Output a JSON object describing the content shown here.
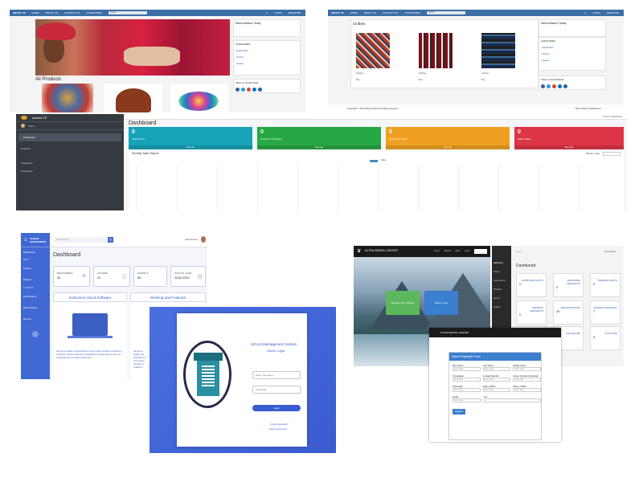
{
  "shop1": {
    "nav": [
      "HOME",
      "ABOUT US",
      "CONTACT US",
      "CATEGORIES"
    ],
    "brand": "ABOUT US",
    "right_nav": [
      "LOGIN",
      "REGISTER"
    ],
    "search_placeholder": "Search",
    "widget_title": "Meet Artisans Today",
    "cat_title": "CATEGORIES",
    "cat_links": [
      "Handicrafts",
      "Clothes",
      "Jewelry"
    ],
    "section_title": "All Products",
    "share_title": "Share on Social Media"
  },
  "shop2": {
    "section_title": "Clothes",
    "items": [
      "Clothes",
      "Clothes",
      "Clothes"
    ],
    "item_sub": [
      "Buy",
      "Buy",
      "Buy"
    ],
    "widget_title": "Meet Artisans Today",
    "cat_title": "CATEGORIES",
    "cat_links": [
      "Handicrafts",
      "Clothes",
      "Jewelry"
    ],
    "share_title": "Share on Social Media",
    "footer_left": "Copyright © 2021 Meet Artisans All rights reserved",
    "footer_right": "Meet Artisans Dashboard"
  },
  "admin": {
    "brand": "AdminLTE",
    "user": "Admin",
    "sidebar": [
      "Dashboard",
      "Products",
      "Categories",
      "Customers"
    ],
    "page_title": "Dashboard",
    "breadcrumb": "Home / Dashboard",
    "cards": [
      {
        "value": "0",
        "label": "Total Orders",
        "color": "#17a2b8"
      },
      {
        "value": "0",
        "label": "Number of Products",
        "color": "#28a745"
      },
      {
        "value": "0",
        "label": "Number of Users",
        "color": "#f0a020"
      },
      {
        "value": "0",
        "label": "Sales Today",
        "color": "#dc3545"
      }
    ],
    "more": "More info",
    "chart_title": "Monthly Sales Report",
    "chart_filter": "Month / Year",
    "legend": "Sales"
  },
  "school": {
    "sidebar_title": "SCHOOL MANAGEMENT",
    "menu": [
      "Dashboard",
      "Course",
      "Subject",
      "Add Student",
      "View Student",
      "Record"
    ],
    "menu_section_1": "MENU",
    "menu_section_2": "STUDENTS",
    "search_placeholder": "Search here",
    "user": "Administrator",
    "page_title": "Dashboard",
    "stats": [
      {
        "label": "REGISTERED",
        "value": "40"
      },
      {
        "label": "COURSE",
        "value": "21"
      },
      {
        "label": "SUBJECT",
        "value": "80"
      },
      {
        "label": "SCHOOL YEAR",
        "value": "2020-2021"
      }
    ],
    "panel1": "Instruction About Software",
    "panel2": "Working and Features",
    "panel_text": "Add some quality, svg illustrations to your project courtesy of unDraw, a constantly updated collection of beautiful svg images that you can use completely free and without attribution!",
    "login_title": "School Management System",
    "login_sub": "Admin Login",
    "username_ph": "Enter Username",
    "password_ph": "Password",
    "login_btn": "Login",
    "forgot": "Forgot Password?",
    "create": "Create an Account"
  },
  "dental": {
    "brand": "ULTRA DENTAL CENTER",
    "nav": [
      "Home",
      "Patients",
      "About",
      "Login"
    ],
    "btn_register": "Register New Patient",
    "btn_admin": "Admin Login",
    "dash_title": "Dashboard",
    "dash_search": "Search",
    "dash_user": "Administrator",
    "dash_sidebar": [
      "Dashboard",
      "Patient",
      "Appointments",
      "Schedule",
      "Record",
      "Settings"
    ],
    "tiles": [
      {
        "label": "APPROVED VISITS",
        "count": "0"
      },
      {
        "label": "APPROVED REQUESTS",
        "count": "0"
      },
      {
        "label": "PENDING VISITS",
        "count": "0"
      },
      {
        "label": "PENDING REQUESTS",
        "count": "0"
      },
      {
        "label": "REGISTRATIONS",
        "count": "26"
      },
      {
        "label": "PENDING REQUEST",
        "count": "7"
      },
      {
        "label": "SCHEDULE",
        "count": "0"
      },
      {
        "label": "CANCELLED",
        "count": "0"
      },
      {
        "label": "DOCTORS",
        "count": "3"
      }
    ],
    "form_title": "Patient Registration Form",
    "fields": [
      "First Name",
      "Last Name",
      "Middle Name",
      "Occupation",
      "Contact Number",
      "Home Number (Optional)",
      "Nationality",
      "Date of Birth",
      "Place of Birth",
      "Email",
      "Sex"
    ],
    "field_ph": "Enter data",
    "register_btn": "Register"
  }
}
